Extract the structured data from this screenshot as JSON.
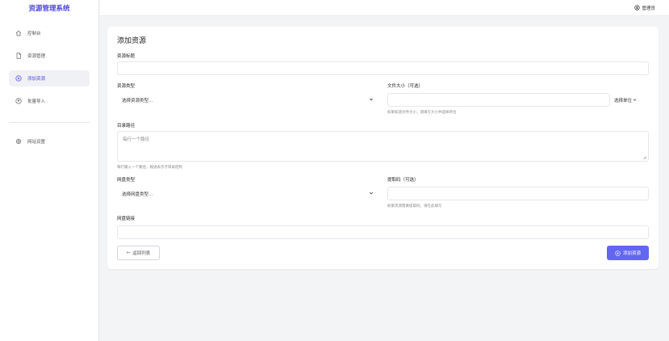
{
  "app": {
    "title": "资源管理系统"
  },
  "sidebar": {
    "items": [
      {
        "label": "控制台",
        "icon": "home-icon"
      },
      {
        "label": "资源管理",
        "icon": "file-icon"
      },
      {
        "label": "添加资源",
        "icon": "plus-circle-icon",
        "active": true
      },
      {
        "label": "批量导入",
        "icon": "upload-icon"
      },
      {
        "label": "网站设置",
        "icon": "gear-icon"
      }
    ]
  },
  "header": {
    "user": "管理员",
    "user_icon": "user-icon"
  },
  "form": {
    "title": "添加资源",
    "resource_title": {
      "label": "资源标题",
      "value": ""
    },
    "resource_type": {
      "label": "资源类型",
      "value": "选择资源类型..."
    },
    "file_size": {
      "label": "文件大小（可选）",
      "value": "",
      "unit": "选择单位",
      "help": "如果知道文件大小，请填写大小并选择单位"
    },
    "paths": {
      "label": "目录路径",
      "placeholder": "每行一个路径",
      "help": "每行输入一个路径，缩进表示子目录结构"
    },
    "disk_type": {
      "label": "网盘类型",
      "value": "选择网盘类型..."
    },
    "code": {
      "label": "提取码（可选）",
      "value": "",
      "help": "如果资源需要提取码，请在此填写"
    },
    "link": {
      "label": "网盘链接",
      "value": ""
    },
    "back_button": "返回列表",
    "submit_button": "添加资源"
  },
  "colors": {
    "accent": "#4f46e5",
    "button": "#6366f1"
  }
}
